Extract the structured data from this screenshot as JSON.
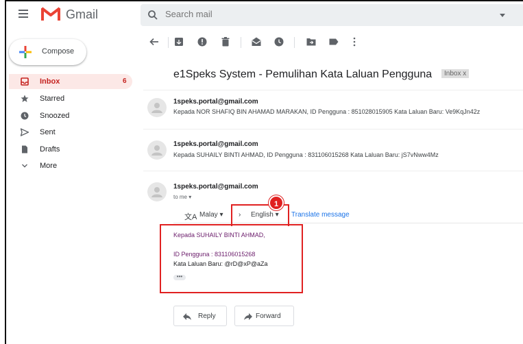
{
  "app": {
    "name": "Gmail"
  },
  "search": {
    "placeholder": "Search mail"
  },
  "compose": {
    "label": "Compose"
  },
  "sidebar": {
    "items": [
      {
        "label": "Inbox",
        "count": "6",
        "icon": "inbox-icon",
        "active": true
      },
      {
        "label": "Starred",
        "icon": "star-icon"
      },
      {
        "label": "Snoozed",
        "icon": "clock-icon"
      },
      {
        "label": "Sent",
        "icon": "send-icon"
      },
      {
        "label": "Drafts",
        "icon": "drafts-icon"
      },
      {
        "label": "More",
        "icon": "chevron-down-icon"
      }
    ]
  },
  "toolbar": {
    "icons": [
      "back-arrow-icon",
      "archive-icon",
      "report-spam-icon",
      "delete-icon",
      "mark-unread-icon",
      "snooze-icon",
      "move-to-icon",
      "labels-icon",
      "more-vert-icon"
    ]
  },
  "thread": {
    "subject": "e1Speks System - Pemulihan Kata Laluan Pengguna",
    "label": "Inbox",
    "label_close": "x",
    "messages": [
      {
        "sender": "1speks.portal@gmail.com",
        "snippet": "Kepada NOR SHAFIQ BIN AHAMAD MARAKAN, ID Pengguna : 851028015905 Kata Laluan Baru: Ve9KqJn42z"
      },
      {
        "sender": "1speks.portal@gmail.com",
        "snippet": "Kepada SUHAILY BINTI AHMAD, ID Pengguna : 831106015268 Kata Laluan Baru: jS7vNww4Mz"
      },
      {
        "sender": "1speks.portal@gmail.com",
        "to": "to me",
        "translate": {
          "from": "Malay",
          "to": "English",
          "link": "Translate message"
        },
        "body": {
          "greeting": "Kepada SUHAILY BINTI AHMAD,",
          "id_line": "ID Pengguna : 831106015268",
          "password_line": "Kata Laluan Baru: @rD@xP@aZa",
          "ellipsis": "•••"
        }
      }
    ]
  },
  "annotation": {
    "callout_number": "1",
    "color": "#e02020"
  },
  "actions": {
    "reply": "Reply",
    "forward": "Forward"
  },
  "colors": {
    "gmail_red": "#ea4335",
    "link_blue": "#1a73e8",
    "body_purple": "#6a1b6a"
  }
}
